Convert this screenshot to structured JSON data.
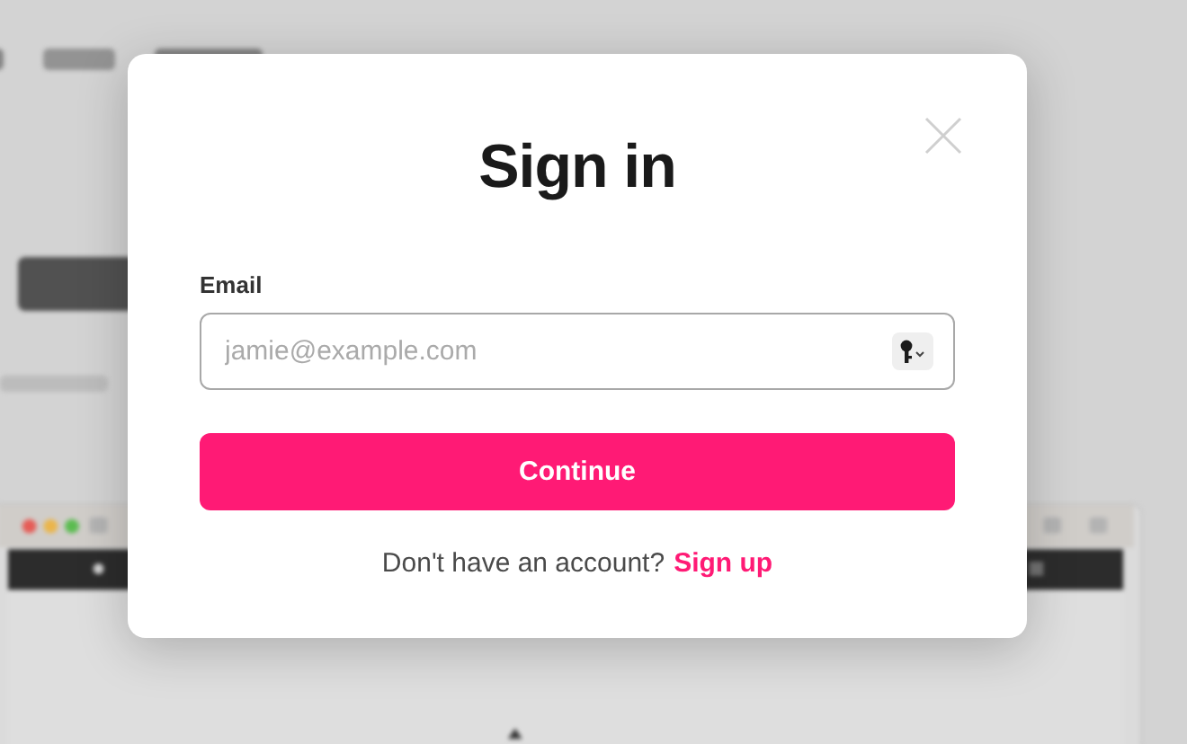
{
  "dialog": {
    "title": "Sign in",
    "email": {
      "label": "Email",
      "placeholder": "jamie@example.com"
    },
    "continue_button": "Continue",
    "footer": {
      "text": "Don't have an account?",
      "link": "Sign up"
    }
  }
}
